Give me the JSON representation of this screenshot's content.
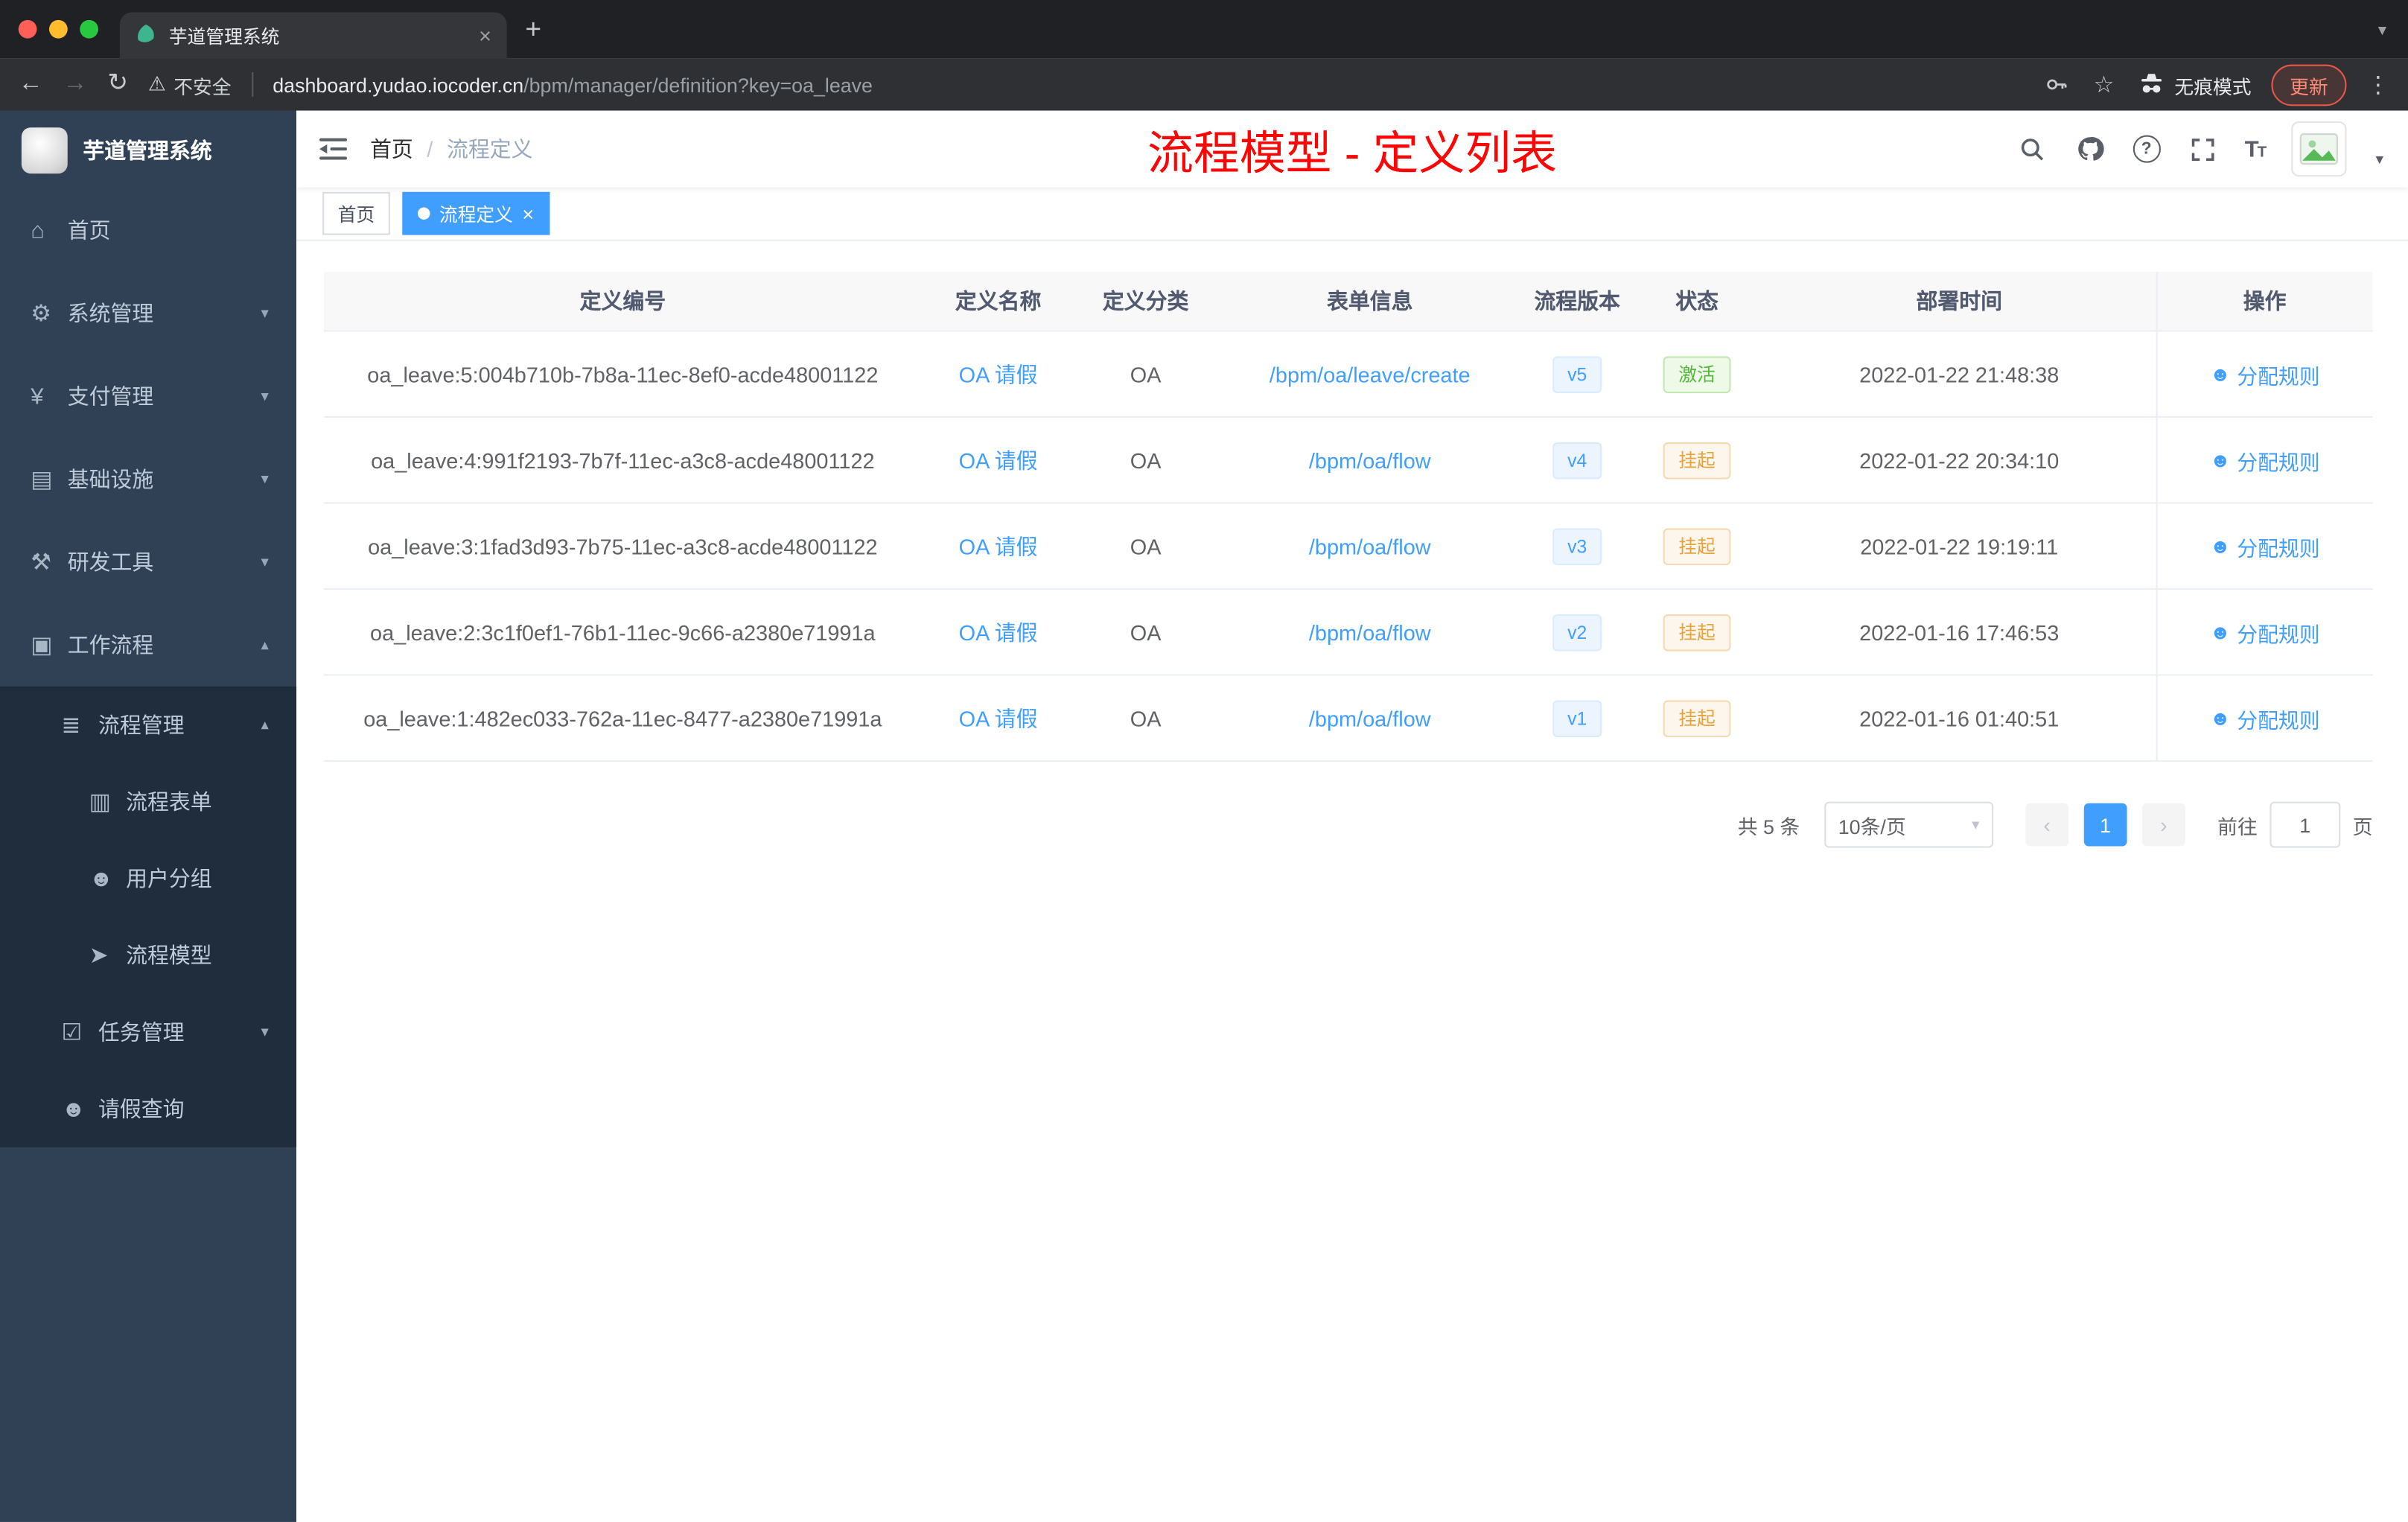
{
  "browser": {
    "tab_title": "芋道管理系统",
    "security_label": "不安全",
    "url_domain": "dashboard.yudao.iocoder.cn",
    "url_path": "/bpm/manager/definition?key=oa_leave",
    "incognito_label": "无痕模式",
    "update_label": "更新"
  },
  "sidebar": {
    "app_title": "芋道管理系统",
    "items": [
      {
        "label": "首页",
        "icon": "home-icon"
      },
      {
        "label": "系统管理",
        "icon": "gear-icon"
      },
      {
        "label": "支付管理",
        "icon": "yen-icon"
      },
      {
        "label": "基础设施",
        "icon": "infrastructure-icon"
      },
      {
        "label": "研发工具",
        "icon": "tools-icon"
      },
      {
        "label": "工作流程",
        "icon": "workflow-icon"
      },
      {
        "label": "流程管理",
        "icon": "process-management-icon"
      },
      {
        "label": "流程表单",
        "icon": "form-icon"
      },
      {
        "label": "用户分组",
        "icon": "user-group-icon"
      },
      {
        "label": "流程模型",
        "icon": "process-model-icon"
      },
      {
        "label": "任务管理",
        "icon": "task-icon"
      },
      {
        "label": "请假查询",
        "icon": "person-icon"
      }
    ]
  },
  "navbar": {
    "breadcrumb_home": "首页",
    "breadcrumb_separator": "/",
    "breadcrumb_current": "流程定义",
    "page_title": "流程模型 - 定义列表"
  },
  "tags": {
    "home": "首页",
    "active": "流程定义"
  },
  "table": {
    "columns": [
      "定义编号",
      "定义名称",
      "定义分类",
      "表单信息",
      "流程版本",
      "状态",
      "部署时间",
      "操作"
    ],
    "action_label": "分配规则",
    "rows": [
      {
        "id": "oa_leave:5:004b710b-7b8a-11ec-8ef0-acde48001122",
        "name": "OA 请假",
        "category": "OA",
        "form": "/bpm/oa/leave/create",
        "version": "v5",
        "status": "激活",
        "time": "2022-01-22 21:48:38"
      },
      {
        "id": "oa_leave:4:991f2193-7b7f-11ec-a3c8-acde48001122",
        "name": "OA 请假",
        "category": "OA",
        "form": "/bpm/oa/flow",
        "version": "v4",
        "status": "挂起",
        "time": "2022-01-22 20:34:10"
      },
      {
        "id": "oa_leave:3:1fad3d93-7b75-11ec-a3c8-acde48001122",
        "name": "OA 请假",
        "category": "OA",
        "form": "/bpm/oa/flow",
        "version": "v3",
        "status": "挂起",
        "time": "2022-01-22 19:19:11"
      },
      {
        "id": "oa_leave:2:3c1f0ef1-76b1-11ec-9c66-a2380e71991a",
        "name": "OA 请假",
        "category": "OA",
        "form": "/bpm/oa/flow",
        "version": "v2",
        "status": "挂起",
        "time": "2022-01-16 17:46:53"
      },
      {
        "id": "oa_leave:1:482ec033-762a-11ec-8477-a2380e71991a",
        "name": "OA 请假",
        "category": "OA",
        "form": "/bpm/oa/flow",
        "version": "v1",
        "status": "挂起",
        "time": "2022-01-16 01:40:51"
      }
    ]
  },
  "pagination": {
    "total": "共 5 条",
    "page_size": "10条/页",
    "page": "1",
    "goto_label": "前往",
    "goto_value": "1",
    "goto_unit": "页"
  },
  "colors": {
    "accent": "#409eff",
    "title_red": "#fb0505",
    "success": "#52b93a",
    "warning": "#e6a23c",
    "sidebar_bg": "#304156",
    "submenu_bg": "#1f2d3d"
  }
}
